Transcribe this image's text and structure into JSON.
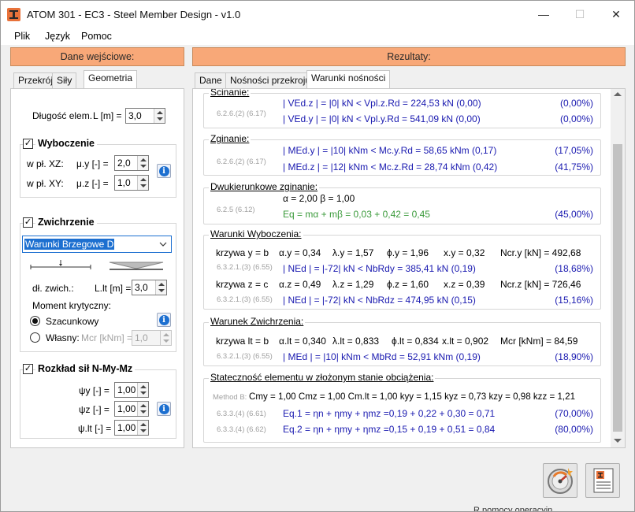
{
  "window": {
    "title": "ATOM 301 - EC3 - Steel Member Design - v1.0",
    "controls": {
      "minimize": "—",
      "maximize": "☐",
      "close": "✕"
    }
  },
  "menu": [
    "Plik",
    "Język",
    "Pomoc"
  ],
  "input_panel": {
    "header": "Dane wejściowe:",
    "tabs": [
      "Przekrój",
      "Siły",
      "Geometria"
    ],
    "active_tab": "Geometria",
    "length_label": "Długość elem.",
    "length_unit_label": "L [m] =",
    "length_value": "3,0",
    "buckling": {
      "title": "Wyboczenie",
      "checked": true,
      "xz_label": "w pł. XZ:",
      "xy_label": "w pł. XY:",
      "muy_label": "μ.y [-] =",
      "muz_label": "μ.z [-] =",
      "muy_value": "2,0",
      "muz_value": "1,0"
    },
    "ltb": {
      "title": "Zwichrzenie",
      "checked": true,
      "boundary_select": "Warunki Brzegowe D",
      "length_label": "dł. zwich.:",
      "lt_label": "L.lt [m] =",
      "lt_value": "3,0",
      "moment_label": "Moment krytyczny:",
      "opt1": "Szacunkowy",
      "opt2": "Własny:",
      "mcr_label": "Mcr [kNm] =",
      "mcr_value": "1,0"
    },
    "distribution": {
      "title": "Rozkład sił N-My-Mz",
      "checked": true,
      "psiy_label": "ψy [-] =",
      "psiz_label": "ψz [-] =",
      "psilt_label": "ψ.lt [-] =",
      "psiy_value": "1,00",
      "psiz_value": "1,00",
      "psilt_value": "1,00"
    }
  },
  "results_panel": {
    "header": "Rezultaty:",
    "tabs": [
      "Dane",
      "Nośności przekroju",
      "Warunki nośności"
    ],
    "active_tab": "Warunki nośności",
    "shear": {
      "title": "Ścinanie:",
      "ref": "6.2.6.(2) (6.17)",
      "line1": "| VEd.z | = |0| kN < Vpl.z.Rd = 224,53 kN (0,00)",
      "pct1": "(0,00%)",
      "line2": "| VEd.y | = |0| kN < Vpl.y.Rd = 541,09 kN (0,00)",
      "pct2": "(0,00%)"
    },
    "bending": {
      "title": "Zginanie:",
      "ref": "6.2.6.(2) (6.17)",
      "line1": "| MEd.y | = |10| kNm < Mc.y.Rd = 58,65 kNm (0,17)",
      "pct1": "(17,05%)",
      "line2": "| MEd.z | = |12| kNm < Mc.z.Rd = 28,74 kNm (0,42)",
      "pct2": "(41,75%)"
    },
    "biaxial": {
      "title": "Dwukierunkowe zginanie:",
      "ref": "6.2.5 (6.12)",
      "line1": "α = 2,00    β = 1,00",
      "line2": "Eq = mα + mβ = 0,03 + 0,42 = 0,45",
      "pct": "(45,00%)"
    },
    "buckling": {
      "title": "Warunki Wyboczenia:",
      "y_row": [
        "krzywa y =  b",
        "α.y = 0,34",
        "λ.y = 1,57",
        "ϕ.y = 1,96",
        "x.y = 0,32",
        "Ncr.y [kN] = 492,68"
      ],
      "ref_y": "6.3.2.1.(3) (6.55)",
      "check_y": "| NEd | = |-72| kN < NbRdy = 385,41 kN (0,19)",
      "pct_y": "(18,68%)",
      "z_row": [
        "krzywa z =  c",
        "α.z = 0,49",
        "λ.z = 1,29",
        "ϕ.z = 1,60",
        "x.z = 0,39",
        "Ncr.z [kN] = 726,46"
      ],
      "ref_z": "6.3.2.1.(3) (6.55)",
      "check_z": "| NEd | = |-72| kN < NbRdz = 474,95 kN (0,15)",
      "pct_z": "(15,16%)"
    },
    "ltb": {
      "title": "Warunek Zwichrzenia:",
      "row": [
        "krzywa lt =  b",
        "α.lt = 0,340",
        "λ.lt = 0,833",
        "ϕ.lt = 0,834",
        "x.lt =  0,902",
        "Mcr [kNm] = 84,59"
      ],
      "ref": "6.3.2.1.(3) (6.55)",
      "check": "| MEd | = |10| kNm < MbRd = 52,91 kNm (0,19)",
      "pct": "(18,90%)"
    },
    "stability": {
      "title": "Stateczność elementu w złożonym stanie obciążenia:",
      "method": "Method B:",
      "coeffs": "Cmy  =  1,00   Cmz = 1,00   Cm.lt = 1,00   kyy  =  1,15    kyz  =  0,73   kzy  =  0,98   kzz  =  1,21",
      "ref1": "6.3.3.(4)  (6.61)",
      "eq1": "Eq.1 = ηn + ηmy + ηmz =0,19 + 0,22 + 0,30 = 0,71",
      "pct1": "(70,00%)",
      "ref2": "6.3.3.(4)  (6.62)",
      "eq2": "Eq.2 = ηn + ηmy + ηmz =0,15 + 0,19 + 0,51 = 0,84",
      "pct2": "(80,00%)"
    }
  },
  "background_text": "R pomocy operacyjn",
  "icons": [
    "app-logo-icon",
    "info-icon",
    "speedometer-icon",
    "report-icon",
    "checkbox-icon",
    "radio-icon",
    "dropdown-chevron-icon"
  ],
  "colors": {
    "header_orange": "#f8a878",
    "result_blue": "#1a1ab0",
    "eq_green": "#3a9a3a",
    "ref_gray": "#a0a0a0"
  }
}
